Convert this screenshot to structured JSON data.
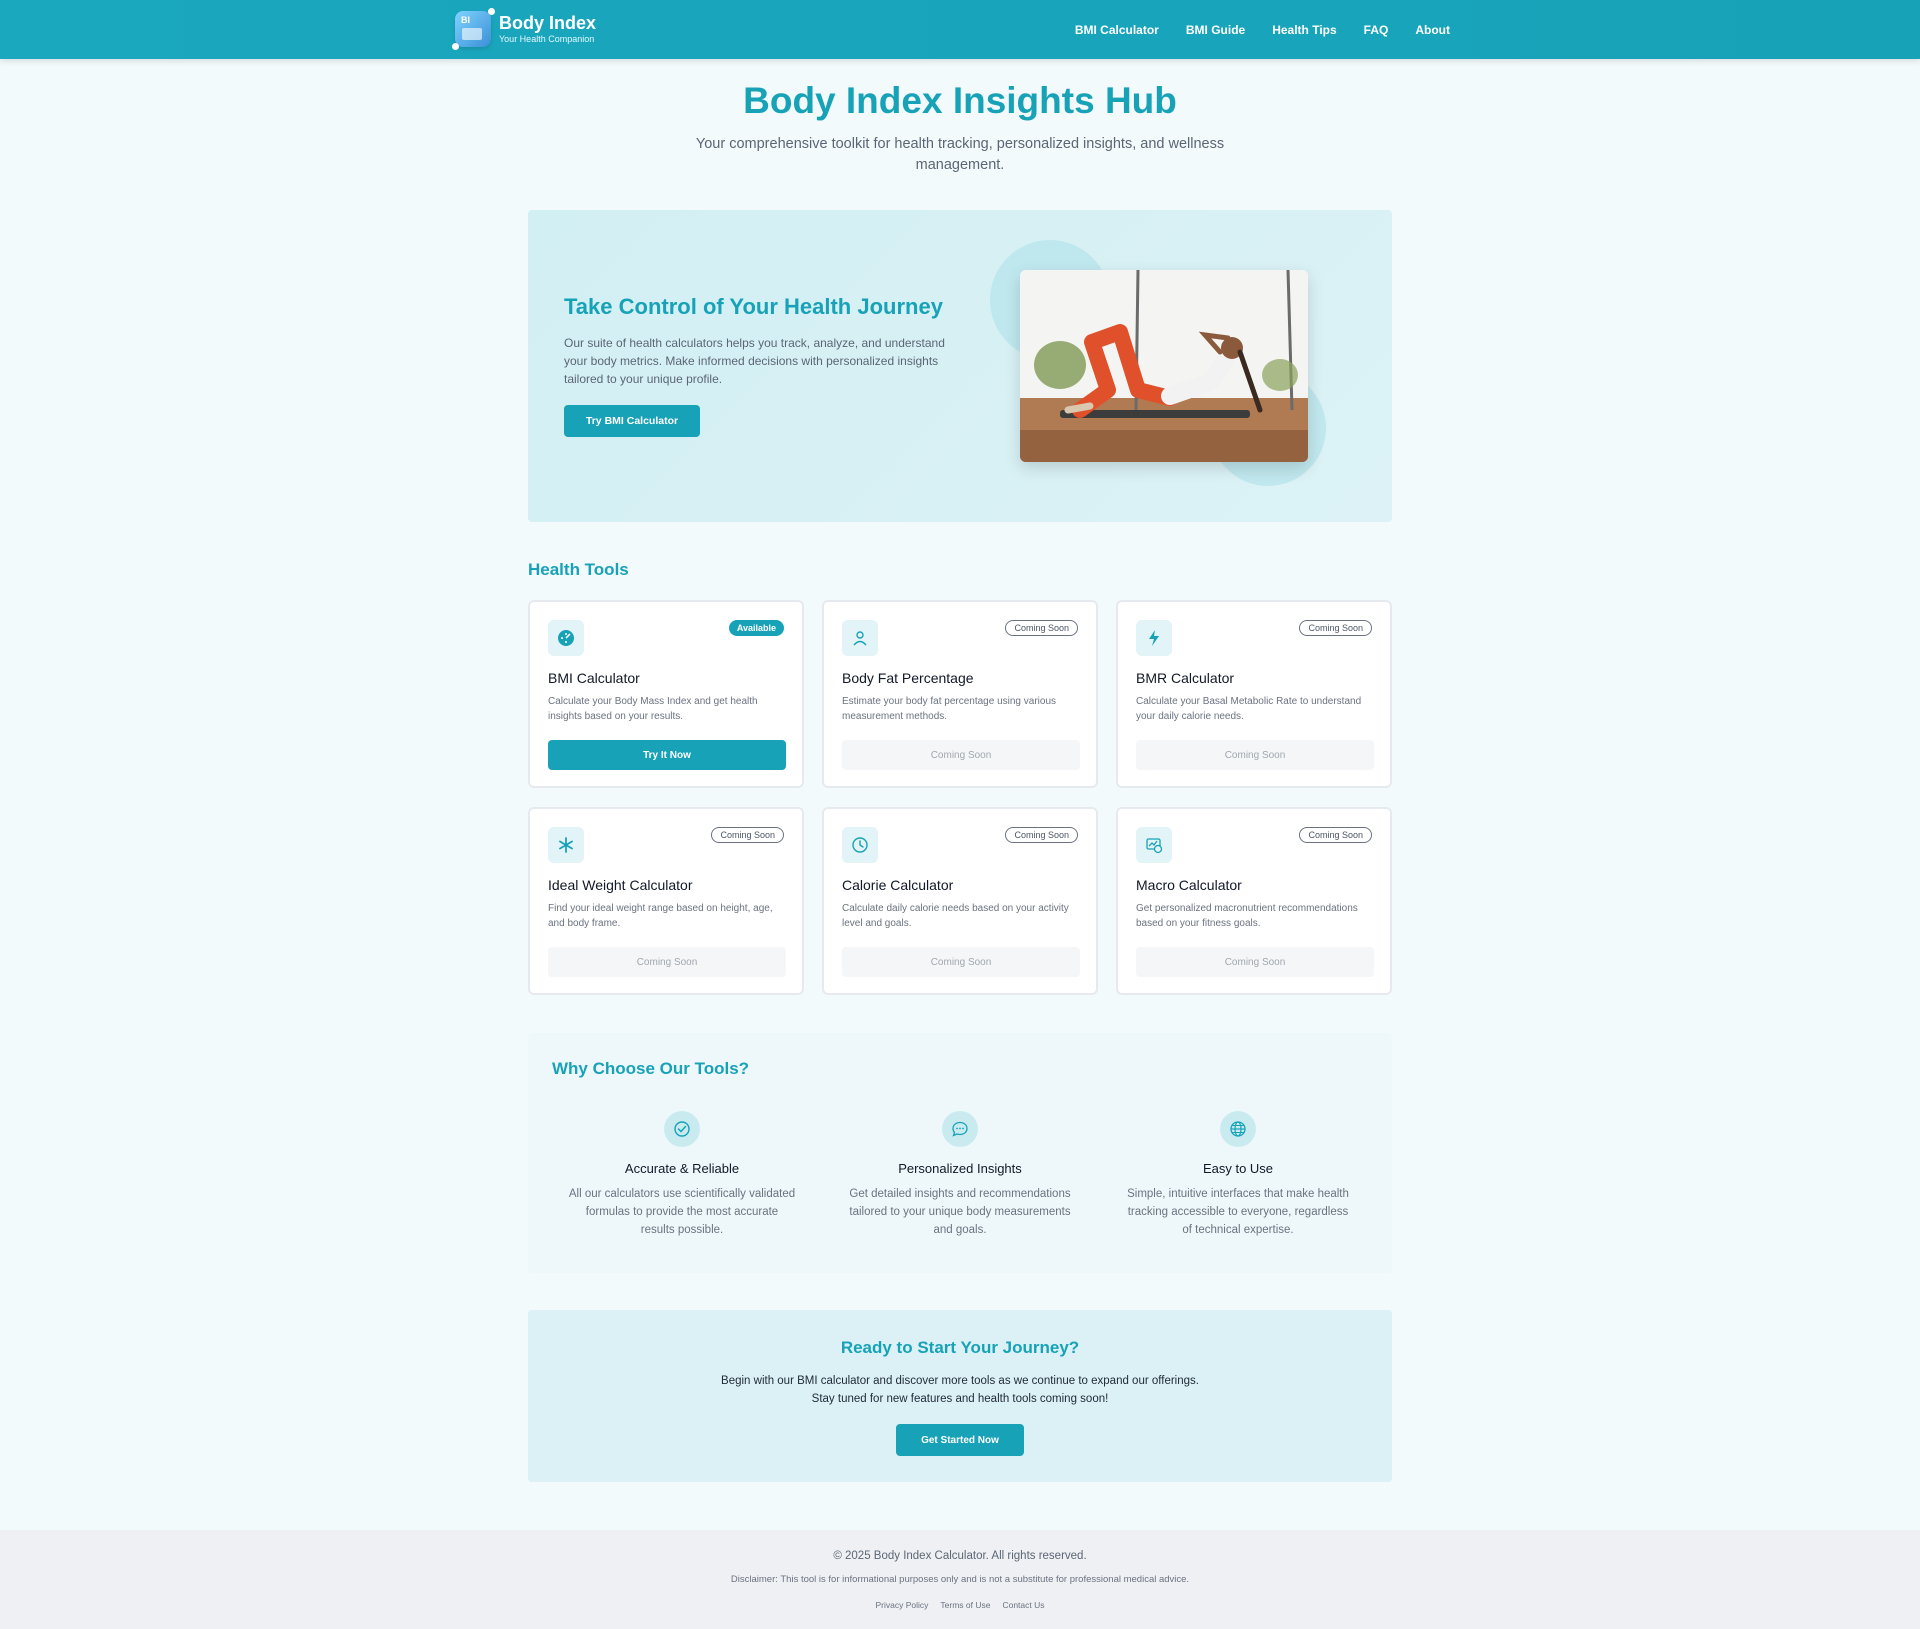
{
  "header": {
    "logo_badge": "BI",
    "brand_title": "Body Index",
    "brand_subtitle": "Your Health Companion",
    "nav": [
      "BMI Calculator",
      "BMI Guide",
      "Health Tips",
      "FAQ",
      "About"
    ]
  },
  "intro": {
    "title": "Body Index Insights Hub",
    "subtitle": "Your comprehensive toolkit for health tracking, personalized insights, and wellness management."
  },
  "hero": {
    "title": "Take Control of Your Health Journey",
    "text": "Our suite of health calculators helps you track, analyze, and understand your body metrics. Make informed decisions with personalized insights tailored to your unique profile.",
    "button": "Try BMI Calculator",
    "image_icon": "woman-exercising-photo"
  },
  "tools": {
    "title": "Health Tools",
    "cards": [
      {
        "icon": "gauge-icon",
        "badge": "Available",
        "title": "BMI Calculator",
        "desc": "Calculate your Body Mass Index and get health insights based on your results.",
        "button": "Try It Now"
      },
      {
        "icon": "person-icon",
        "badge": "Coming Soon",
        "title": "Body Fat Percentage",
        "desc": "Estimate your body fat percentage using various measurement methods.",
        "button": "Coming Soon"
      },
      {
        "icon": "lightning-icon",
        "badge": "Coming Soon",
        "title": "BMR Calculator",
        "desc": "Calculate your Basal Metabolic Rate to understand your daily calorie needs.",
        "button": "Coming Soon"
      },
      {
        "icon": "asterisk-icon",
        "badge": "Coming Soon",
        "title": "Ideal Weight Calculator",
        "desc": "Find your ideal weight range based on height, age, and body frame.",
        "button": "Coming Soon"
      },
      {
        "icon": "clock-icon",
        "badge": "Coming Soon",
        "title": "Calorie Calculator",
        "desc": "Calculate daily calorie needs based on your activity level and goals.",
        "button": "Coming Soon"
      },
      {
        "icon": "chart-image-icon",
        "badge": "Coming Soon",
        "title": "Macro Calculator",
        "desc": "Get personalized macronutrient recommendations based on your fitness goals.",
        "button": "Coming Soon"
      }
    ]
  },
  "why": {
    "title": "Why Choose Our Tools?",
    "features": [
      {
        "icon": "check-circle-icon",
        "title": "Accurate & Reliable",
        "desc": "All our calculators use scientifically validated formulas to provide the most accurate results possible."
      },
      {
        "icon": "chat-bubble-icon",
        "title": "Personalized Insights",
        "desc": "Get detailed insights and recommendations tailored to your unique body measurements and goals."
      },
      {
        "icon": "globe-icon",
        "title": "Easy to Use",
        "desc": "Simple, intuitive interfaces that make health tracking accessible to everyone, regardless of technical expertise."
      }
    ]
  },
  "cta": {
    "title": "Ready to Start Your Journey?",
    "line1": "Begin with our BMI calculator and discover more tools as we continue to expand our offerings.",
    "line2": "Stay tuned for new features and health tools coming soon!",
    "button": "Get Started Now"
  },
  "footer": {
    "copyright": "© 2025 Body Index Calculator. All rights reserved.",
    "disclaimer": "Disclaimer: This tool is for informational purposes only and is not a substitute for professional medical advice.",
    "links": [
      "Privacy Policy",
      "Terms of Use",
      "Contact Us"
    ]
  },
  "colors": {
    "accent": "#17a2b8",
    "hero_bg": "#d2eff3",
    "page_bg": "#f3fafc"
  }
}
